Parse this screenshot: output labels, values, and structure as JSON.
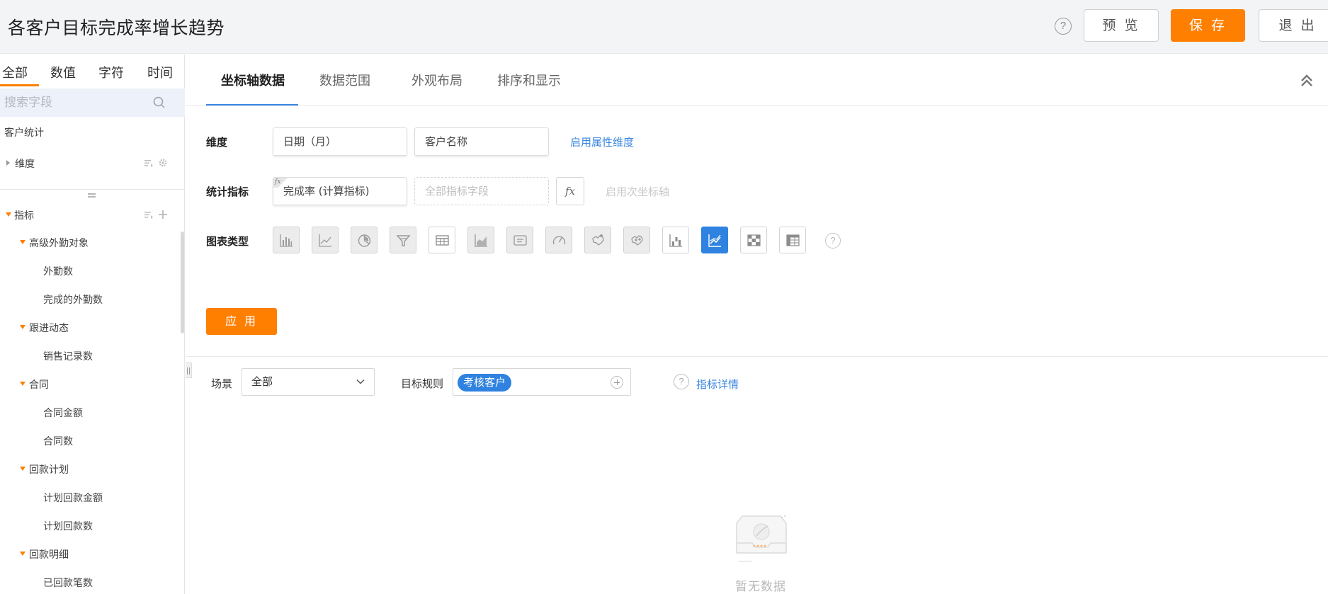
{
  "header": {
    "title": "各客户目标完成率增长趋势",
    "preview_label": "预 览",
    "save_label": "保 存",
    "exit_label": "退 出",
    "help_glyph": "?"
  },
  "sidebar": {
    "tabs": [
      "全部",
      "数值",
      "字符",
      "时间"
    ],
    "search_placeholder": "搜索字段",
    "section_title": "客户统计",
    "dimension_label": "维度",
    "metrics_label": "指标",
    "groups": [
      {
        "label": "高级外勤对象",
        "items": [
          "外勤数",
          "完成的外勤数"
        ]
      },
      {
        "label": "跟进动态",
        "items": [
          "销售记录数"
        ]
      },
      {
        "label": "合同",
        "items": [
          "合同金额",
          "合同数"
        ]
      },
      {
        "label": "回款计划",
        "items": [
          "计划回款金额",
          "计划回款数"
        ]
      },
      {
        "label": "回款明细",
        "items": [
          "已回款笔数"
        ]
      }
    ]
  },
  "main": {
    "tabs": [
      "坐标轴数据",
      "数据范围",
      "外观布局",
      "排序和显示"
    ],
    "dimension": {
      "label": "维度",
      "fields": [
        "日期（月）",
        "客户名称"
      ],
      "link": "启用属性维度"
    },
    "metric": {
      "label": "统计指标",
      "fx_badge": "fx",
      "field": "完成率 (计算指标)",
      "placeholder": "全部指标字段",
      "fx_button": "fx",
      "secondary_axis": "启用次坐标轴"
    },
    "chart_type": {
      "label": "图表类型",
      "icons": [
        "bar-chart-icon",
        "line-chart-icon",
        "pie-chart-icon",
        "funnel-chart-icon",
        "table-chart-icon",
        "area-chart-icon",
        "card-chart-icon",
        "gauge-chart-icon",
        "map-chart-icon",
        "scatter-map-icon",
        "waterfall-chart-icon",
        "trend-line-chart-icon",
        "heatmap-chart-icon",
        "pivot-table-icon"
      ],
      "active_index": 11,
      "help_glyph": "?"
    },
    "apply_label": "应 用"
  },
  "filters": {
    "scene_label": "场景",
    "scene_value": "全部",
    "rule_label": "目标规则",
    "rule_tag": "考核客户",
    "help_glyph": "?",
    "details_link": "指标详情"
  },
  "empty_state": {
    "text": "暂无数据"
  },
  "colors": {
    "accent_orange": "#ff7f00",
    "accent_blue": "#2f82e0",
    "link_blue": "#3a86e0"
  }
}
